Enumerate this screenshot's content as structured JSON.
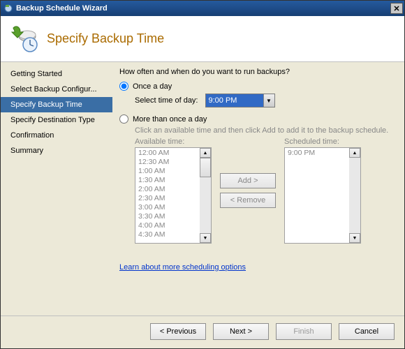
{
  "window": {
    "title": "Backup Schedule Wizard"
  },
  "header": {
    "title": "Specify Backup Time"
  },
  "sidebar": {
    "items": [
      {
        "label": "Getting Started"
      },
      {
        "label": "Select Backup Configur..."
      },
      {
        "label": "Specify Backup Time"
      },
      {
        "label": "Specify Destination Type"
      },
      {
        "label": "Confirmation"
      },
      {
        "label": "Summary"
      }
    ],
    "selected_index": 2
  },
  "content": {
    "question": "How often and when do you want to run backups?",
    "once": {
      "label": "Once a day",
      "time_label": "Select time of day:",
      "time_value": "9:00 PM"
    },
    "multi": {
      "label": "More than once a day",
      "hint": "Click an available time and then click Add to add it to the backup schedule.",
      "available_label": "Available time:",
      "scheduled_label": "Scheduled time:",
      "available_times": [
        "12:00 AM",
        "12:30 AM",
        "1:00 AM",
        "1:30 AM",
        "2:00 AM",
        "2:30 AM",
        "3:00 AM",
        "3:30 AM",
        "4:00 AM",
        "4:30 AM"
      ],
      "scheduled_times": [
        "9:00 PM"
      ],
      "add_label": "Add >",
      "remove_label": "< Remove"
    },
    "selected_mode": "once",
    "link": "Learn about more scheduling options"
  },
  "footer": {
    "previous": "< Previous",
    "next": "Next >",
    "finish": "Finish",
    "cancel": "Cancel"
  }
}
